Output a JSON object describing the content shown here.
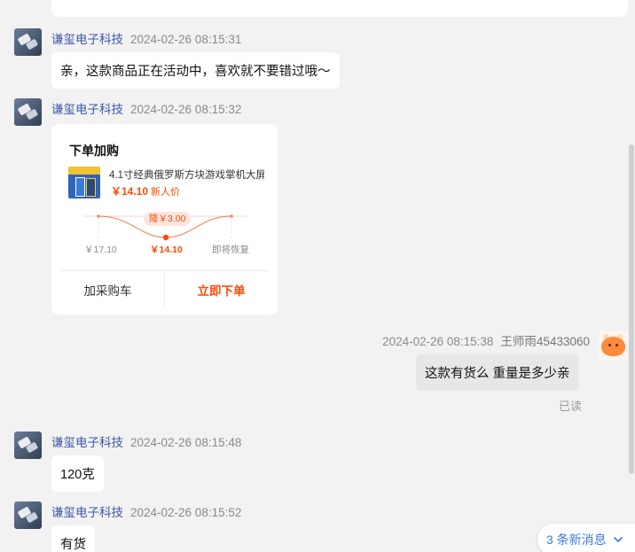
{
  "messages": [
    {
      "sender": "谦玺电子科技",
      "time": "2024-02-26 08:15:31",
      "text": "亲，这款商品正在活动中，喜欢就不要错过哦～"
    },
    {
      "sender": "谦玺电子科技",
      "time": "2024-02-26 08:15:32",
      "card": {
        "title": "下单加购",
        "product_name": "4.1寸经典俄罗斯方块游戏掌机大屏",
        "price": "￥14.10",
        "price_tag": "新人价",
        "drop_badge": "降￥3.00",
        "price_old": "￥17.10",
        "price_now": "￥14.10",
        "price_next": "即将恢复",
        "add_cart_label": "加采购车",
        "order_label": "立即下单"
      }
    },
    {
      "sender": "王师雨45433060",
      "time": "2024-02-26 08:15:38",
      "text": "这款有货么  重量是多少亲",
      "status": "已读"
    },
    {
      "sender": "谦玺电子科技",
      "time": "2024-02-26 08:15:48",
      "text": "120克"
    },
    {
      "sender": "谦玺电子科技",
      "time": "2024-02-26 08:15:52",
      "text": "有货"
    }
  ],
  "new_messages_label": "3 条新消息",
  "colors": {
    "accent": "#ff4a00",
    "link": "#3b7ddb",
    "sender": "#3c58a7"
  }
}
